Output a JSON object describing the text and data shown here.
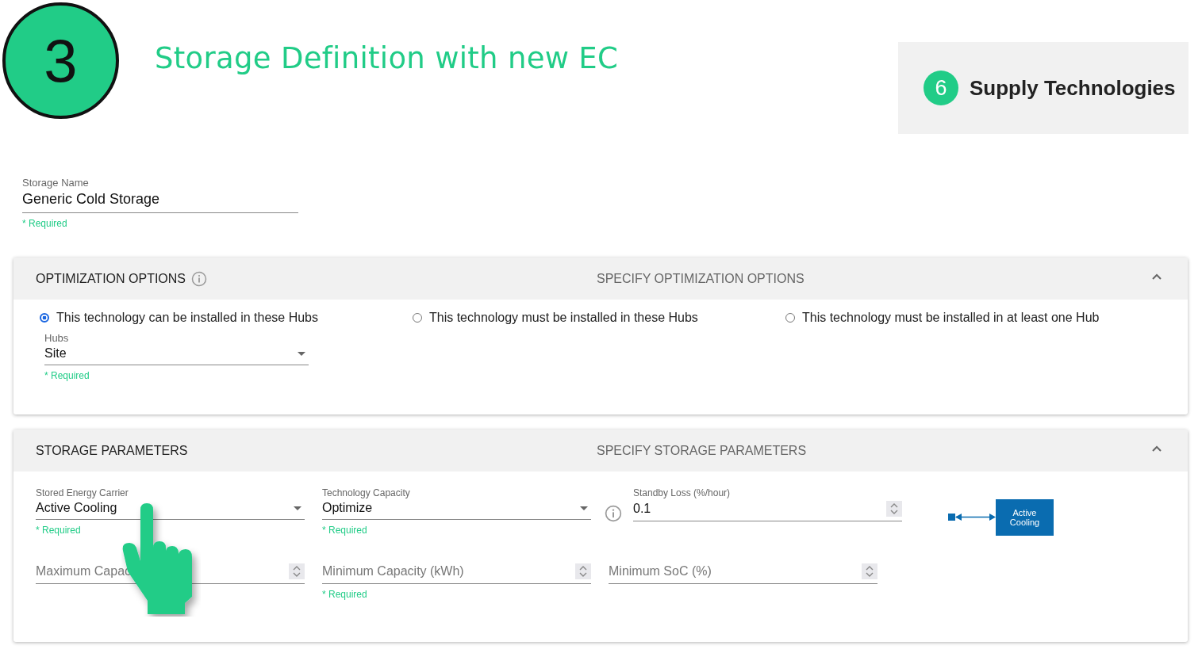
{
  "step": {
    "number": "3",
    "title": "Storage Definition with new EC"
  },
  "section_badge": {
    "number": "6",
    "label": "Supply Technologies"
  },
  "storage_name": {
    "label": "Storage Name",
    "value": "Generic Cold Storage",
    "hint": "* Required"
  },
  "optimization_options": {
    "title": "OPTIMIZATION OPTIONS",
    "subtitle": "SPECIFY OPTIMIZATION OPTIONS",
    "expanded": true,
    "radios": [
      {
        "label": "This technology can be installed in these Hubs",
        "selected": true
      },
      {
        "label": "This technology must be installed in these Hubs",
        "selected": false
      },
      {
        "label": "This technology must be installed in at least one Hub",
        "selected": false
      }
    ],
    "hubs": {
      "label": "Hubs",
      "value": "Site",
      "hint": "* Required"
    }
  },
  "storage_parameters": {
    "title": "STORAGE PARAMETERS",
    "subtitle": "SPECIFY STORAGE PARAMETERS",
    "expanded": true,
    "rows": [
      [
        {
          "kind": "select",
          "label": "Stored Energy Carrier",
          "value": "Active Cooling",
          "hint": "* Required"
        },
        {
          "kind": "select",
          "label": "Technology Capacity",
          "value": "Optimize",
          "hint": "* Required",
          "info": true
        },
        {
          "kind": "number",
          "label": "Standby Loss (%/hour)",
          "value": "0.1"
        }
      ],
      [
        {
          "kind": "number",
          "placeholder": "Maximum Capac"
        },
        {
          "kind": "number",
          "placeholder": "Minimum Capacity (kWh)",
          "hint": "* Required"
        },
        {
          "kind": "number",
          "placeholder": "Minimum SoC (%)"
        }
      ]
    ],
    "diagram": {
      "label": "Active Cooling"
    }
  }
}
